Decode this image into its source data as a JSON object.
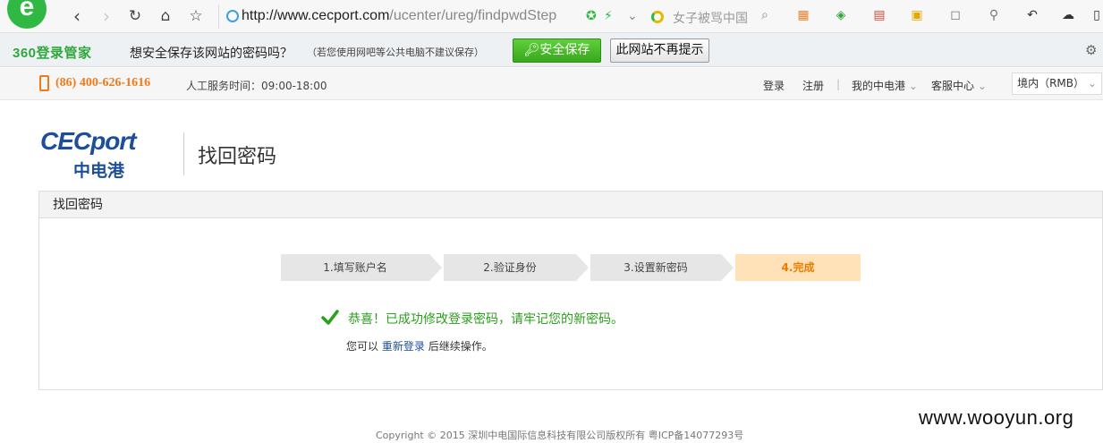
{
  "browser": {
    "logo_letter": "e",
    "url_host": "http://www.cecport.com",
    "url_path": "/ucenter/ureg/findpwdStep",
    "search_placeholder": "女子被骂中国",
    "icons": {
      "back": "chevron-left-icon",
      "forward": "chevron-right-icon",
      "refresh": "refresh-icon",
      "home": "home-icon",
      "favorite": "star-icon"
    }
  },
  "password_bar": {
    "brand": "360登录管家",
    "question": "想安全保存该网站的密码吗？",
    "note": "（若您使用网吧等公共电脑不建议保存）",
    "save_label": "安全保存",
    "never_label": "此网站不再提示"
  },
  "topbar": {
    "phone": "(86) 400-626-1616",
    "service_hours": "人工服务时间：09:00-18:00",
    "links": {
      "login": "登录",
      "register": "注册",
      "my_account": "我的中电港",
      "customer_service": "客服中心"
    },
    "separator": "|",
    "currency": "境内（RMB）"
  },
  "header": {
    "logo_en": "CECport",
    "logo_cn": "中电港",
    "title": "找回密码"
  },
  "panel": {
    "title": "找回密码",
    "steps": [
      {
        "label": "1.填写账户名"
      },
      {
        "label": "2.验证身份"
      },
      {
        "label": "3.设置新密码"
      },
      {
        "label": "4.完成"
      }
    ],
    "active_step": 4,
    "success_message": "恭喜！已成功修改登录密码，请牢记您的新密码。",
    "relogin_prefix": "您可以",
    "relogin_link": "重新登录",
    "relogin_suffix": "后继续操作。"
  },
  "footer": {
    "copyright": "Copyright © 2015 深圳中电国际信息科技有限公司版权所有    粤ICP备14077293号"
  },
  "watermark": "www.wooyun.org",
  "colors": {
    "brand_blue": "#1d4e9c",
    "accent_orange": "#ef7a00",
    "success_green": "#2aa01c",
    "save_button_green": "#38a81c"
  }
}
